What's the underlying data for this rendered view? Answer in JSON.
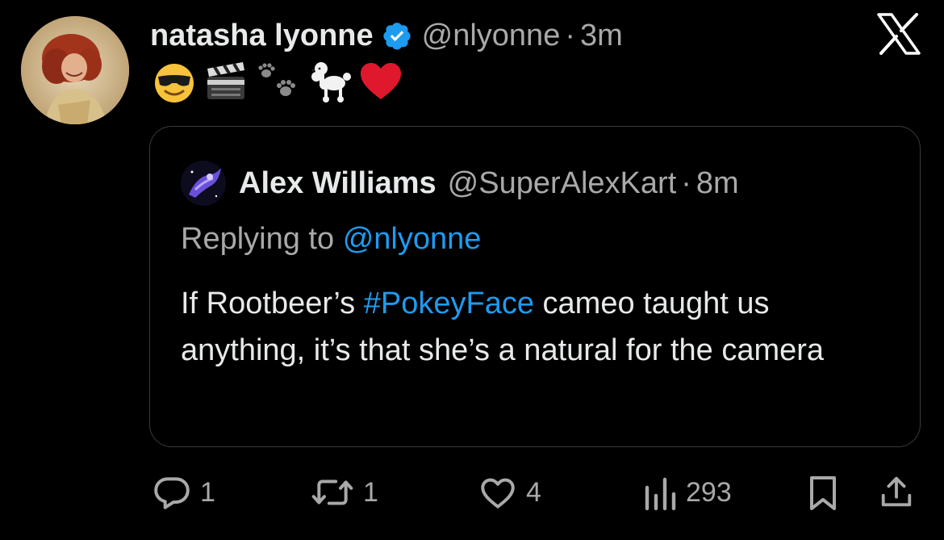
{
  "tweet": {
    "display_name": "natasha lyonne",
    "verified": true,
    "handle": "@nlyonne",
    "separator": "·",
    "time": "3m",
    "emojis": [
      "smiling-face-with-sunglasses",
      "clapper-board",
      "paw-prints",
      "poodle",
      "red-heart"
    ]
  },
  "quote": {
    "display_name": "Alex Williams",
    "handle": "@SuperAlexKart",
    "separator": "·",
    "time": "8m",
    "replying_prefix": "Replying to",
    "replying_mention": "@nlyonne",
    "text_before": "If Rootbeer’s ",
    "hashtag": "#PokeyFace",
    "text_after": " cameo taught us anything, it’s that she’s a natural for the camera"
  },
  "actions": {
    "replies": "1",
    "reposts": "1",
    "likes": "4",
    "views": "293"
  },
  "icons": {
    "close": "x-logo-icon",
    "reply": "reply-icon",
    "repost": "repost-icon",
    "like": "heart-icon",
    "views": "views-icon",
    "bookmark": "bookmark-icon",
    "share": "share-icon"
  },
  "colors": {
    "background": "#000000",
    "text": "#e7e9ea",
    "muted": "#a9a9a9",
    "link": "#1d9bf0",
    "verified": "#1d9bf0",
    "border": "#3a3a3a"
  }
}
